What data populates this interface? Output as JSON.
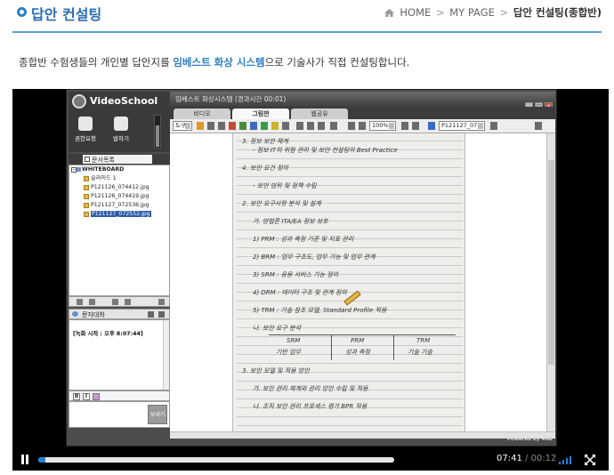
{
  "header": {
    "title": "답안 컨설팅",
    "breadcrumb": {
      "home": "HOME",
      "sep1": ">",
      "mypage": "MY PAGE",
      "sep2": ">",
      "current": "답안 컨설팅(종합반)"
    },
    "accent_color": "#2f7fc0"
  },
  "description": {
    "before": "종합반 수험생들의 개인별 답안지를 ",
    "highlight": "임베스트 화상 시스템",
    "after": "으로 기술사가 직접 컨설팅합니다."
  },
  "app": {
    "logo": "VideoSchool",
    "window_title": "임베스트 화상시스템 (경과시간 00:01)",
    "controls": {
      "rights": "권한요청",
      "speak": "발하기"
    },
    "tabs": [
      "비디오",
      "그림판",
      "웹공유"
    ],
    "active_tab": "그림판",
    "toolbar": {
      "tool_label": "도구",
      "zoom": "100%",
      "file": "P121127_07"
    },
    "docs": {
      "tab_label": "문서목록",
      "root": "WHITEBOARD",
      "items": [
        "슬라이드 1",
        "P121126_074412.jpg",
        "P121126_074419.jpg",
        "P121127_072536.jpg",
        "P121127_072552.jpg"
      ],
      "selected_index": 4
    },
    "chat": {
      "tab_label": "문자대화",
      "log": "[녹화 시작 : 오후 8:07:44]",
      "bold": "B",
      "italic": "I",
      "send": "보내기"
    },
    "powered_by": "Powered by 4NB"
  },
  "player": {
    "current_time": "07:41",
    "separator": "/",
    "duration": "00:12",
    "progress": 0.02,
    "buffered": 1.0
  },
  "handwriting": [
    "3. 정보 보안 체계",
    "- 정보 IT의 위험 관리 및 보안 컨설팅의 Best Practice",
    "4. 보안 요건 정의",
    "- 보안 범위 및 정책 수립",
    "2. 보안 요구사항 분석 및 설계",
    "가. 방법론 ITA/EA 정보 보호",
    "1) PRM : 성과 측정 기준 및 지표 관리",
    "2) BRM : 업무 구조도, 업무 기능 및 업무 관계",
    "3) SRM : 응용 서비스 기능 정의",
    "4) DRM : 데이터 구조 및 관계 정의",
    "5) TRM : 기술 참조 모델, Standard Profile 적용",
    "나. 보안 요구 분석",
    "3. 보안 모델 및 적용 방안",
    "가. 보안 관리 체계와 관리 방안 수립 및 적용",
    "나. 조직 보안 관리 프로세스 평가 BPR 적용"
  ],
  "table_cells": [
    "SRM",
    "PRM",
    "TRM",
    "기반 업무",
    "성과 측정",
    "기술 기술"
  ]
}
